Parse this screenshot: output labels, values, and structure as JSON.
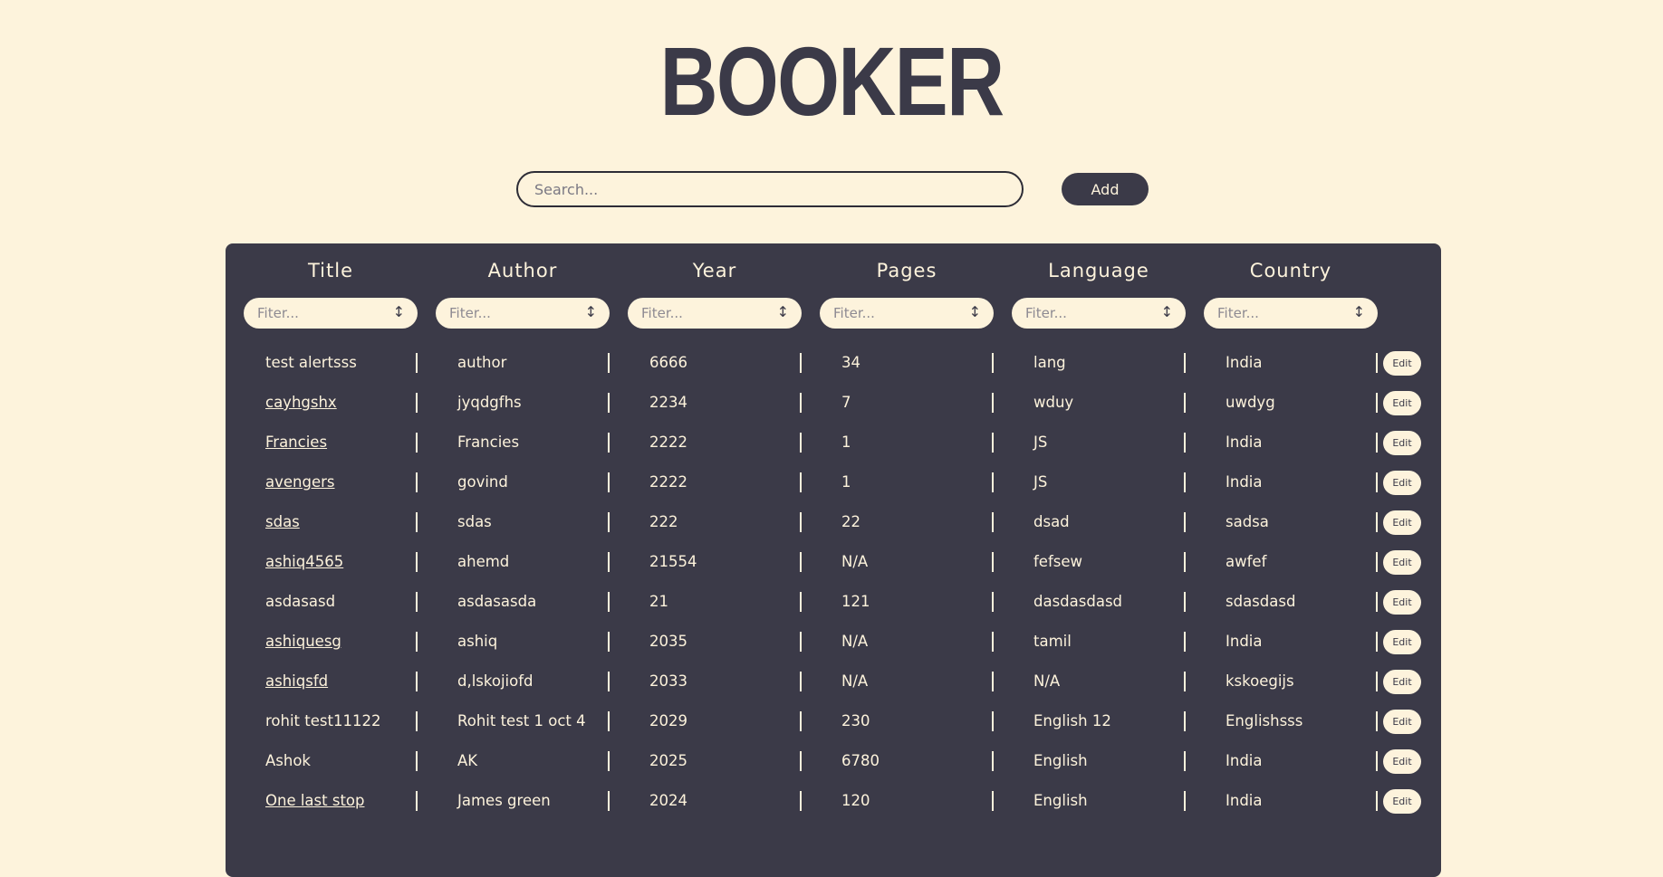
{
  "app": {
    "logo": "BOOKER"
  },
  "toolbar": {
    "search_placeholder": "Search...",
    "add_label": "Add"
  },
  "table": {
    "columns": [
      {
        "label": "Title",
        "filter_placeholder": "Fiter...",
        "sort_icon": "↕"
      },
      {
        "label": "Author",
        "filter_placeholder": "Fiter...",
        "sort_icon": "↕"
      },
      {
        "label": "Year",
        "filter_placeholder": "Fiter...",
        "sort_icon": "↕"
      },
      {
        "label": "Pages",
        "filter_placeholder": "Fiter...",
        "sort_icon": "↕"
      },
      {
        "label": "Language",
        "filter_placeholder": "Fiter...",
        "sort_icon": "↕"
      },
      {
        "label": "Country",
        "filter_placeholder": "Fiter...",
        "sort_icon": "↕"
      }
    ],
    "edit_label": "Edit",
    "rows": [
      {
        "title": "test alertsss",
        "title_link": false,
        "author": "author",
        "year": "6666",
        "pages": "34",
        "language": "lang",
        "country": "India"
      },
      {
        "title": "cayhgshx",
        "title_link": true,
        "author": "jyqdgfhs",
        "year": "2234",
        "pages": "7",
        "language": "wduy",
        "country": "uwdyg"
      },
      {
        "title": "Francies",
        "title_link": true,
        "author": "Francies",
        "year": "2222",
        "pages": "1",
        "language": "JS",
        "country": "India"
      },
      {
        "title": "avengers",
        "title_link": true,
        "author": "govind",
        "year": "2222",
        "pages": "1",
        "language": "JS",
        "country": "India"
      },
      {
        "title": "sdas",
        "title_link": true,
        "author": "sdas",
        "year": "222",
        "pages": "22",
        "language": "dsad",
        "country": "sadsa"
      },
      {
        "title": "ashiq4565",
        "title_link": true,
        "author": "ahemd",
        "year": "21554",
        "pages": "N/A",
        "language": "fefsew",
        "country": "awfef"
      },
      {
        "title": "asdasasd",
        "title_link": false,
        "author": "asdasasda",
        "year": "21",
        "pages": "121",
        "language": "dasdasdasd",
        "country": "sdasdasd"
      },
      {
        "title": "ashiquesg",
        "title_link": true,
        "author": "ashiq",
        "year": "2035",
        "pages": "N/A",
        "language": "tamil",
        "country": "India"
      },
      {
        "title": "ashiqsfd",
        "title_link": true,
        "author": "d,lskojiofd",
        "year": "2033",
        "pages": "N/A",
        "language": "N/A",
        "country": "kskoegijs"
      },
      {
        "title": "rohit test11122",
        "title_link": false,
        "author": "Rohit test 1 oct 4",
        "year": "2029",
        "pages": "230",
        "language": "English 12",
        "country": "Englishsss"
      },
      {
        "title": "Ashok",
        "title_link": false,
        "author": "AK",
        "year": "2025",
        "pages": "6780",
        "language": "English",
        "country": "India"
      },
      {
        "title": "One last stop",
        "title_link": true,
        "author": "James green",
        "year": "2024",
        "pages": "120",
        "language": "English",
        "country": "India"
      }
    ]
  },
  "colors": {
    "background": "#fdf3dc",
    "panel": "#3b3a48",
    "text_light": "#fdf3dc"
  }
}
